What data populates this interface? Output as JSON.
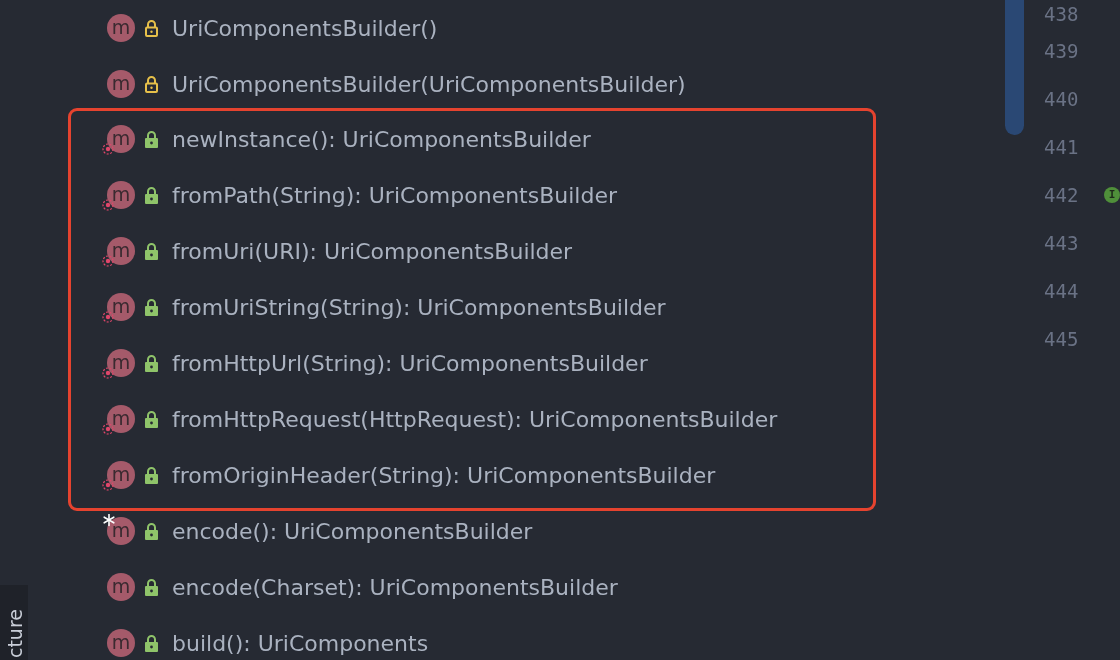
{
  "groups": [
    {
      "framed": false,
      "members": [
        {
          "icon_letter": "m",
          "name": "UriComponentsBuilder()",
          "private": true,
          "static": false,
          "starred": false
        },
        {
          "icon_letter": "m",
          "name": "UriComponentsBuilder(UriComponentsBuilder)",
          "private": true,
          "static": false,
          "starred": false
        }
      ]
    },
    {
      "framed": true,
      "members": [
        {
          "icon_letter": "m",
          "name": "newInstance(): UriComponentsBuilder",
          "private": false,
          "static": true,
          "starred": false
        },
        {
          "icon_letter": "m",
          "name": "fromPath(String): UriComponentsBuilder",
          "private": false,
          "static": true,
          "starred": false
        },
        {
          "icon_letter": "m",
          "name": "fromUri(URI): UriComponentsBuilder",
          "private": false,
          "static": true,
          "starred": false
        },
        {
          "icon_letter": "m",
          "name": "fromUriString(String): UriComponentsBuilder",
          "private": false,
          "static": true,
          "starred": false
        },
        {
          "icon_letter": "m",
          "name": "fromHttpUrl(String): UriComponentsBuilder",
          "private": false,
          "static": true,
          "starred": false
        },
        {
          "icon_letter": "m",
          "name": "fromHttpRequest(HttpRequest): UriComponentsBuilder",
          "private": false,
          "static": true,
          "starred": false
        },
        {
          "icon_letter": "m",
          "name": "fromOriginHeader(String): UriComponentsBuilder",
          "private": false,
          "static": true,
          "starred": false
        }
      ]
    },
    {
      "framed": false,
      "members": [
        {
          "icon_letter": "m",
          "name": "encode(): UriComponentsBuilder",
          "private": false,
          "static": false,
          "starred": true
        },
        {
          "icon_letter": "m",
          "name": "encode(Charset): UriComponentsBuilder",
          "private": false,
          "static": false,
          "starred": false
        },
        {
          "icon_letter": "m",
          "name": "build(): UriComponents",
          "private": false,
          "static": false,
          "starred": false
        }
      ]
    }
  ],
  "line_numbers": [
    {
      "number": "438"
    },
    {
      "number": "439"
    },
    {
      "number": "440"
    },
    {
      "number": "441"
    },
    {
      "number": "442",
      "marker": {
        "letter": "I"
      }
    },
    {
      "number": "443"
    },
    {
      "number": "444"
    },
    {
      "number": "445"
    }
  ],
  "side_tab": {
    "label": "cture"
  }
}
